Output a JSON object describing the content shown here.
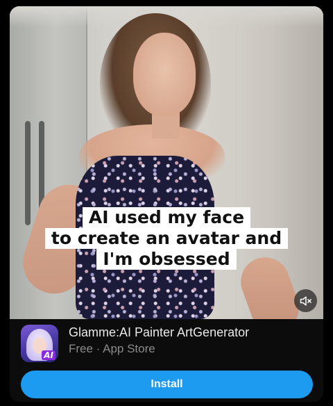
{
  "video": {
    "caption_lines": [
      "AI used my face",
      "to create an avatar and",
      "I'm obsessed"
    ],
    "mute_icon": "speaker-muted-icon"
  },
  "app": {
    "name": "Glamme:AI Painter ArtGenerator",
    "meta": "Free · App Store",
    "icon": "app-avatar-icon",
    "icon_badge": "AI"
  },
  "cta": {
    "install_label": "Install"
  },
  "colors": {
    "background": "#000000",
    "card": "#0c0c0c",
    "accent": "#1d9bf0",
    "primary_text": "#e9e9e9",
    "secondary_text": "#8b8b8b"
  }
}
